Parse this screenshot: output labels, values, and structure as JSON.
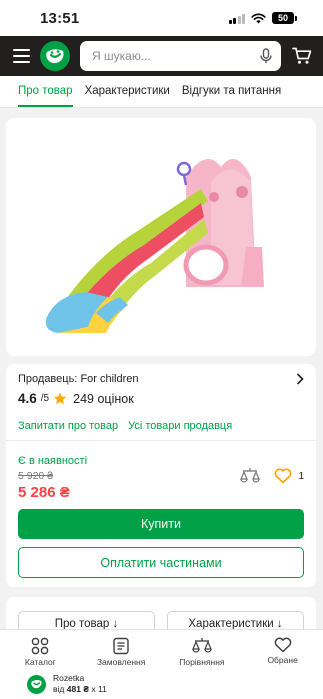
{
  "status_bar": {
    "time": "13:51",
    "battery": "50"
  },
  "header": {
    "search_placeholder": "Я шукаю..."
  },
  "tabs": [
    {
      "label": "Про товар",
      "active": true
    },
    {
      "label": "Характеристики",
      "active": false
    },
    {
      "label": "Відгуки та питання",
      "active": false
    }
  ],
  "seller": {
    "label": "Продавець:",
    "name": "For children",
    "rating": "4.6",
    "rating_of": "/5",
    "reviews": "249 оцінок",
    "link_ask": "Запитати про товар",
    "link_all": "Усі товари продавця"
  },
  "purchase": {
    "availability": "Є в наявності",
    "old_price": "5 920 ₴",
    "price": "5 286 ₴",
    "favorite_count": "1",
    "buy_label": "Купити",
    "installments_label": "Оплатити частинами"
  },
  "section_chips": {
    "about": "Про товар ↓",
    "specs": "Характеристики ↓"
  },
  "bottom_nav": [
    {
      "label": "Каталог"
    },
    {
      "label": "Замовлення"
    },
    {
      "label": "Порівняння"
    },
    {
      "label": "Обране"
    }
  ],
  "app_banner": {
    "name": "Rozetka",
    "from": "від",
    "amount": "481 ₴",
    "times": "x 11"
  },
  "colors": {
    "brand_green": "#00a046",
    "price_red": "#f84147",
    "header_dark": "#221f1f"
  }
}
